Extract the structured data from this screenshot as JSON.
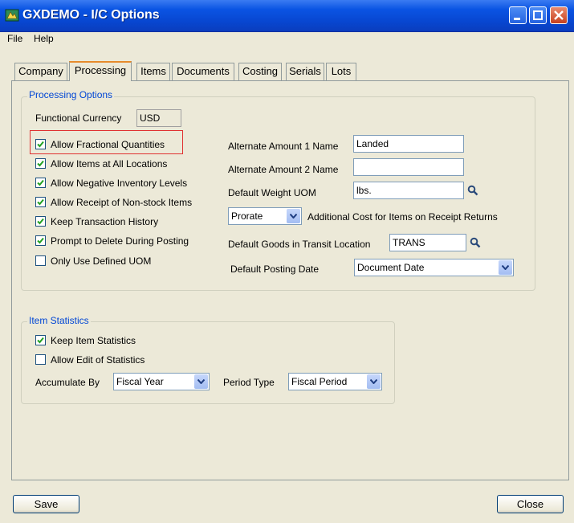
{
  "window": {
    "title": "GXDEMO - I/C Options"
  },
  "menu": [
    {
      "label": "File"
    },
    {
      "label": "Help"
    }
  ],
  "tabs": [
    {
      "label": "Company"
    },
    {
      "label": "Processing"
    },
    {
      "label": "Items"
    },
    {
      "label": "Documents"
    },
    {
      "label": "Costing"
    },
    {
      "label": "Serials"
    },
    {
      "label": "Lots"
    }
  ],
  "active_tab": "Processing",
  "processing_options": {
    "title": "Processing Options",
    "functional_currency_label": "Functional Currency",
    "functional_currency_value": "USD",
    "checkboxes": [
      {
        "label": "Allow Fractional Quantities",
        "checked": true
      },
      {
        "label": "Allow Items at All Locations",
        "checked": true
      },
      {
        "label": "Allow Negative Inventory Levels",
        "checked": true
      },
      {
        "label": "Allow Receipt of Non-stock Items",
        "checked": true
      },
      {
        "label": "Keep Transaction History",
        "checked": true
      },
      {
        "label": "Prompt to Delete During Posting",
        "checked": true
      },
      {
        "label": "Only Use Defined UOM",
        "checked": false
      }
    ],
    "alt_amount_1_label": "Alternate Amount 1 Name",
    "alt_amount_1_value": "Landed",
    "alt_amount_2_label": "Alternate Amount 2 Name",
    "alt_amount_2_value": "",
    "default_weight_uom_label": "Default Weight UOM",
    "default_weight_uom_value": "lbs.",
    "additional_cost_select": "Prorate",
    "additional_cost_label": "Additional Cost for Items on Receipt Returns",
    "goods_in_transit_label": "Default Goods in Transit Location",
    "goods_in_transit_value": "TRANS",
    "posting_date_label": "Default Posting Date",
    "posting_date_value": "Document Date"
  },
  "item_statistics": {
    "title": "Item Statistics",
    "checkboxes": [
      {
        "label": "Keep Item Statistics",
        "checked": true
      },
      {
        "label": "Allow Edit of Statistics",
        "checked": false
      }
    ],
    "accumulate_by_label": "Accumulate By",
    "accumulate_by_value": "Fiscal Year",
    "period_type_label": "Period Type",
    "period_type_value": "Fiscal Period"
  },
  "buttons": {
    "save": "Save",
    "close": "Close"
  },
  "colors": {
    "titlebar": "#0a54e3",
    "group_title": "#0046d5",
    "highlight": "#e03030",
    "tab_active_accent": "#e68b2c"
  },
  "icons": [
    "app-icon",
    "minimize-icon",
    "maximize-icon",
    "close-icon",
    "checkmark-icon",
    "magnifier-icon",
    "dropdown-arrow-icon"
  ]
}
